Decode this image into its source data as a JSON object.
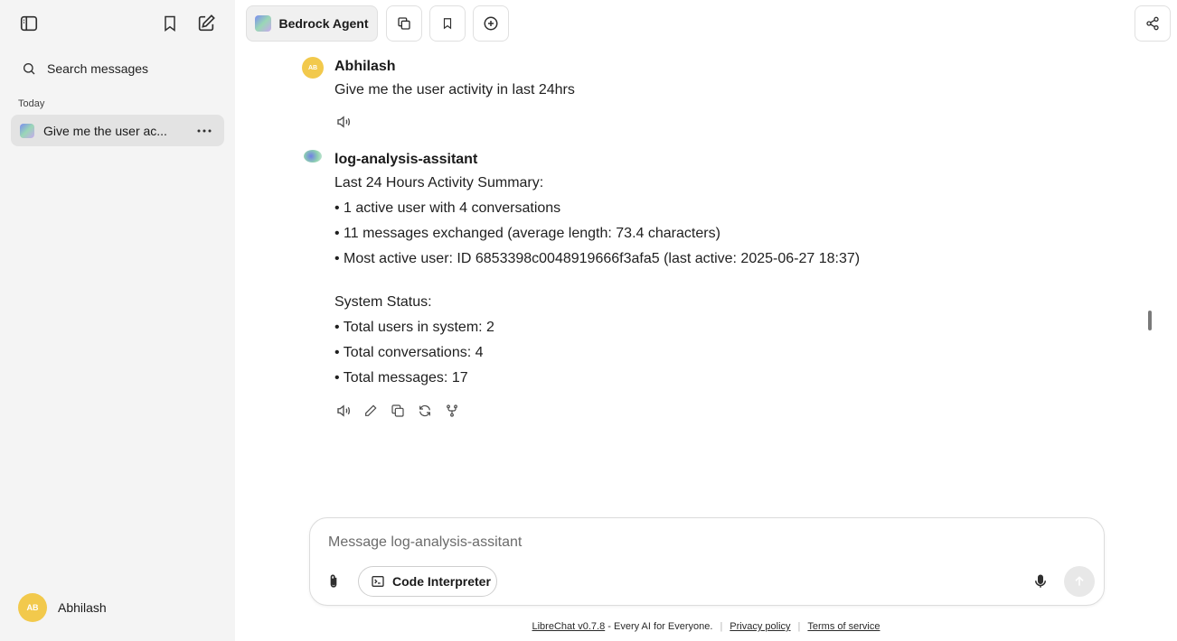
{
  "sidebar": {
    "search_placeholder": "Search messages",
    "section_today": "Today",
    "conversation_title": "Give me the user ac...",
    "account_initials": "AB",
    "account_name": "Abhilash"
  },
  "header": {
    "agent_name": "Bedrock Agent"
  },
  "messages": [
    {
      "author": "Abhilash",
      "avatar_initials": "AB",
      "lines": [
        "Give me the user activity in last 24hrs"
      ]
    },
    {
      "author": "log-analysis-assitant",
      "lines": [
        "Last 24 Hours Activity Summary:",
        "• 1 active user with 4 conversations",
        "• 11 messages exchanged (average length: 73.4 characters)",
        "• Most active user: ID 6853398c0048919666f3afa5 (last active: 2025-06-27 18:37)",
        "System Status:",
        "• Total users in system: 2",
        "• Total conversations: 4",
        "• Total messages: 17"
      ]
    }
  ],
  "composer": {
    "placeholder": "Message log-analysis-assitant",
    "tool_label": "Code Interpreter"
  },
  "footer": {
    "version_link": "LibreChat v0.7.8",
    "tagline": " - Every AI for Everyone.",
    "privacy": "Privacy policy",
    "terms": "Terms of service"
  },
  "icons": {
    "sidebar_toggle": "sidebar-toggle-icon",
    "bookmark": "bookmark-icon",
    "new_chat": "new-chat-icon",
    "search": "search-icon",
    "more": "more-horizontal-icon",
    "copy": "copy-icon",
    "add": "plus-circle-icon",
    "share": "share-icon",
    "speaker": "speaker-icon",
    "edit": "pencil-icon",
    "regenerate": "refresh-icon",
    "fork": "fork-icon",
    "attach": "paperclip-icon",
    "terminal": "terminal-icon",
    "mic": "microphone-icon",
    "send": "arrow-up-icon"
  },
  "colors": {
    "sidebar_bg": "#f4f4f4",
    "avatar": "#f2c94c",
    "active_item": "#e3e3e3"
  }
}
